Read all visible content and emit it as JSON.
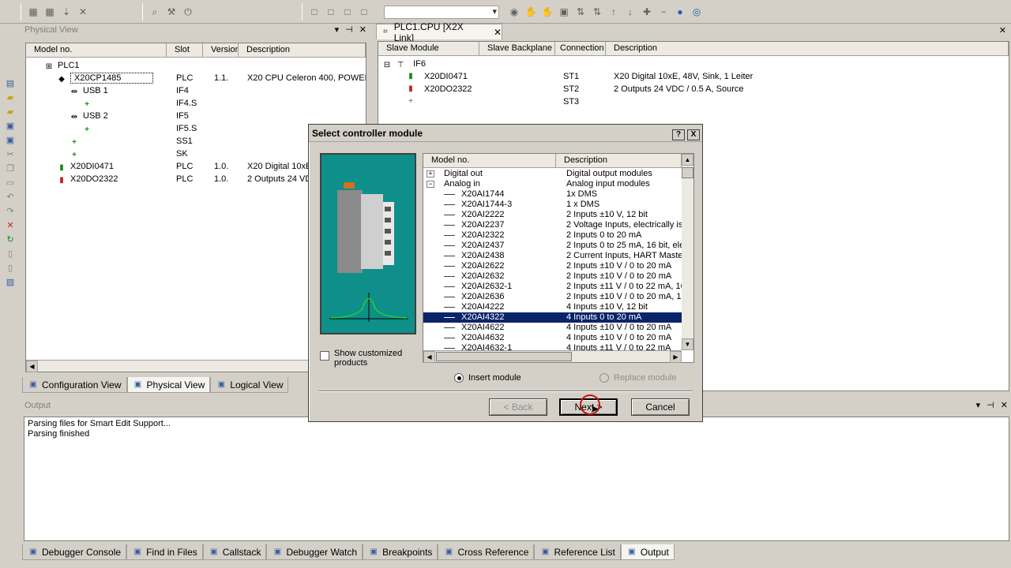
{
  "physical_view": {
    "title": "Physical View",
    "columns": [
      "Model no.",
      "Slot",
      "Version",
      "Description"
    ],
    "rows": [
      {
        "model": "PLC1",
        "slot": "",
        "version": "",
        "desc": "",
        "indent": 0
      },
      {
        "model": "X20CP1485",
        "slot": "PLC",
        "version": "1.1.",
        "desc": "X20 CPU Celeron 400, POWER",
        "indent": 1
      },
      {
        "model": "USB 1",
        "slot": "IF4",
        "version": "",
        "desc": "",
        "indent": 2
      },
      {
        "model": "",
        "slot": "IF4.S",
        "version": "",
        "desc": "",
        "indent": 3
      },
      {
        "model": "USB 2",
        "slot": "IF5",
        "version": "",
        "desc": "",
        "indent": 2
      },
      {
        "model": "",
        "slot": "IF5.S",
        "version": "",
        "desc": "",
        "indent": 3
      },
      {
        "model": "",
        "slot": "SS1",
        "version": "",
        "desc": "",
        "indent": 2
      },
      {
        "model": "",
        "slot": "SK",
        "version": "",
        "desc": "",
        "indent": 2
      },
      {
        "model": "X20DI0471",
        "slot": "PLC",
        "version": "1.0.",
        "desc": "X20 Digital 10xE",
        "indent": 1
      },
      {
        "model": "X20DO2322",
        "slot": "PLC",
        "version": "1.0.",
        "desc": "2 Outputs 24 VD",
        "indent": 1
      }
    ]
  },
  "link_view": {
    "tab_label": "PLC1.CPU [X2X Link]",
    "columns": [
      "Slave Module",
      "Slave Backplane",
      "Connection",
      "Description"
    ],
    "root": "IF6",
    "rows": [
      {
        "model": "X20DI0471",
        "conn": "ST1",
        "desc": "X20 Digital 10xE, 48V, Sink, 1 Leiter"
      },
      {
        "model": "X20DO2322",
        "conn": "ST2",
        "desc": "2 Outputs 24 VDC / 0.5 A, Source"
      },
      {
        "model": "",
        "conn": "ST3",
        "desc": ""
      }
    ]
  },
  "view_tabs": [
    {
      "label": "Configuration View",
      "icon": "gear-icon"
    },
    {
      "label": "Physical View",
      "icon": "plc-icon"
    },
    {
      "label": "Logical View",
      "icon": "folder-icon"
    }
  ],
  "output": {
    "title": "Output",
    "lines": [
      "Parsing files for Smart Edit Support...",
      "Parsing finished"
    ]
  },
  "bottom_tabs": [
    {
      "label": "Debugger Console",
      "icon": "bug-icon"
    },
    {
      "label": "Find in Files",
      "icon": "find-icon"
    },
    {
      "label": "Callstack",
      "icon": "stack-icon"
    },
    {
      "label": "Debugger Watch",
      "icon": "watch-icon"
    },
    {
      "label": "Breakpoints",
      "icon": "breakpoint-icon"
    },
    {
      "label": "Cross Reference",
      "icon": "crossref-icon"
    },
    {
      "label": "Reference List",
      "icon": "list-icon"
    },
    {
      "label": "Output",
      "icon": "output-icon"
    }
  ],
  "dialog": {
    "title": "Select controller module",
    "help": "?",
    "close": "X",
    "columns": [
      "Model no.",
      "Description"
    ],
    "items": [
      {
        "expander": "+",
        "model": "Digital out",
        "desc": "Digital output modules",
        "level": 0,
        "selected": false
      },
      {
        "expander": "−",
        "model": "Analog in",
        "desc": "Analog input modules",
        "level": 0,
        "selected": false
      },
      {
        "expander": "",
        "model": "X20AI1744",
        "desc": "1x DMS",
        "level": 1,
        "selected": false
      },
      {
        "expander": "",
        "model": "X20AI1744-3",
        "desc": "1 x DMS",
        "level": 1,
        "selected": false
      },
      {
        "expander": "",
        "model": "X20AI2222",
        "desc": "2 Inputs ±10 V, 12 bit",
        "level": 1,
        "selected": false
      },
      {
        "expander": "",
        "model": "X20AI2237",
        "desc": "2 Voltage Inputs, electrically isc",
        "level": 1,
        "selected": false
      },
      {
        "expander": "",
        "model": "X20AI2322",
        "desc": "2 Inputs 0 to 20 mA",
        "level": 1,
        "selected": false
      },
      {
        "expander": "",
        "model": "X20AI2437",
        "desc": "2 Inputs 0 to 25 mA, 16 bit, elec",
        "level": 1,
        "selected": false
      },
      {
        "expander": "",
        "model": "X20AI2438",
        "desc": "2 Current Inputs, HART Master",
        "level": 1,
        "selected": false
      },
      {
        "expander": "",
        "model": "X20AI2622",
        "desc": "2 Inputs ±10 V / 0 to 20 mA",
        "level": 1,
        "selected": false
      },
      {
        "expander": "",
        "model": "X20AI2632",
        "desc": "2 Inputs ±10 V / 0 to 20 mA",
        "level": 1,
        "selected": false
      },
      {
        "expander": "",
        "model": "X20AI2632-1",
        "desc": "2 Inputs ±11 V / 0 to 22 mA, 16",
        "level": 1,
        "selected": false
      },
      {
        "expander": "",
        "model": "X20AI2636",
        "desc": "2 Inputs ±10 V / 0 to 20 mA, 16",
        "level": 1,
        "selected": false
      },
      {
        "expander": "",
        "model": "X20AI4222",
        "desc": "4 Inputs ±10 V, 12 bit",
        "level": 1,
        "selected": false
      },
      {
        "expander": "",
        "model": "X20AI4322",
        "desc": "4 Inputs 0 to 20 mA",
        "level": 1,
        "selected": true
      },
      {
        "expander": "",
        "model": "X20AI4622",
        "desc": "4 Inputs ±10 V / 0 to 20 mA",
        "level": 1,
        "selected": false
      },
      {
        "expander": "",
        "model": "X20AI4632",
        "desc": "4 Inputs ±10 V / 0 to 20 mA",
        "level": 1,
        "selected": false
      },
      {
        "expander": "",
        "model": "X20AI4632-1",
        "desc": "4 Inputs ±11 V / 0 to 22 mA",
        "level": 1,
        "selected": false
      }
    ],
    "show_customized_label": "Show customized products",
    "show_customized_checked": false,
    "insert_label": "Insert module",
    "replace_label": "Replace module",
    "insert_selected": true,
    "back_label": "< Back",
    "next_label": "Next >",
    "cancel_label": "Cancel"
  },
  "colors": {
    "accent": "#0a246a",
    "preview_bg": "#0e8f8a",
    "chrome": "#d4d0c8"
  }
}
